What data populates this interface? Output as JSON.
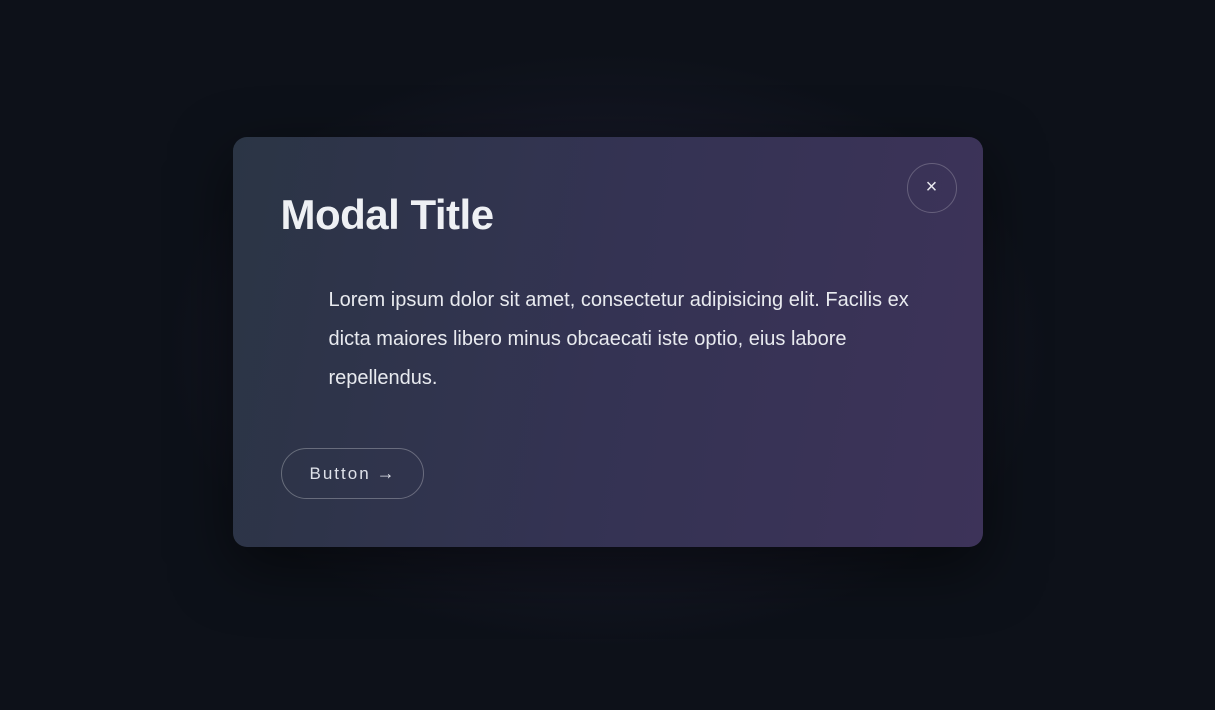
{
  "modal": {
    "title": "Modal Title",
    "body": "Lorem ipsum dolor sit amet, consectetur adipisicing elit. Facilis ex dicta maiores libero minus obcaecati iste optio, eius labore repellendus.",
    "close_label": "×",
    "action_label": "Button",
    "action_arrow": "→"
  },
  "colors": {
    "background": "#0d1119",
    "modal_gradient_from": "#2b3545",
    "modal_gradient_to": "#3d3359",
    "text": "#e8eaef"
  }
}
